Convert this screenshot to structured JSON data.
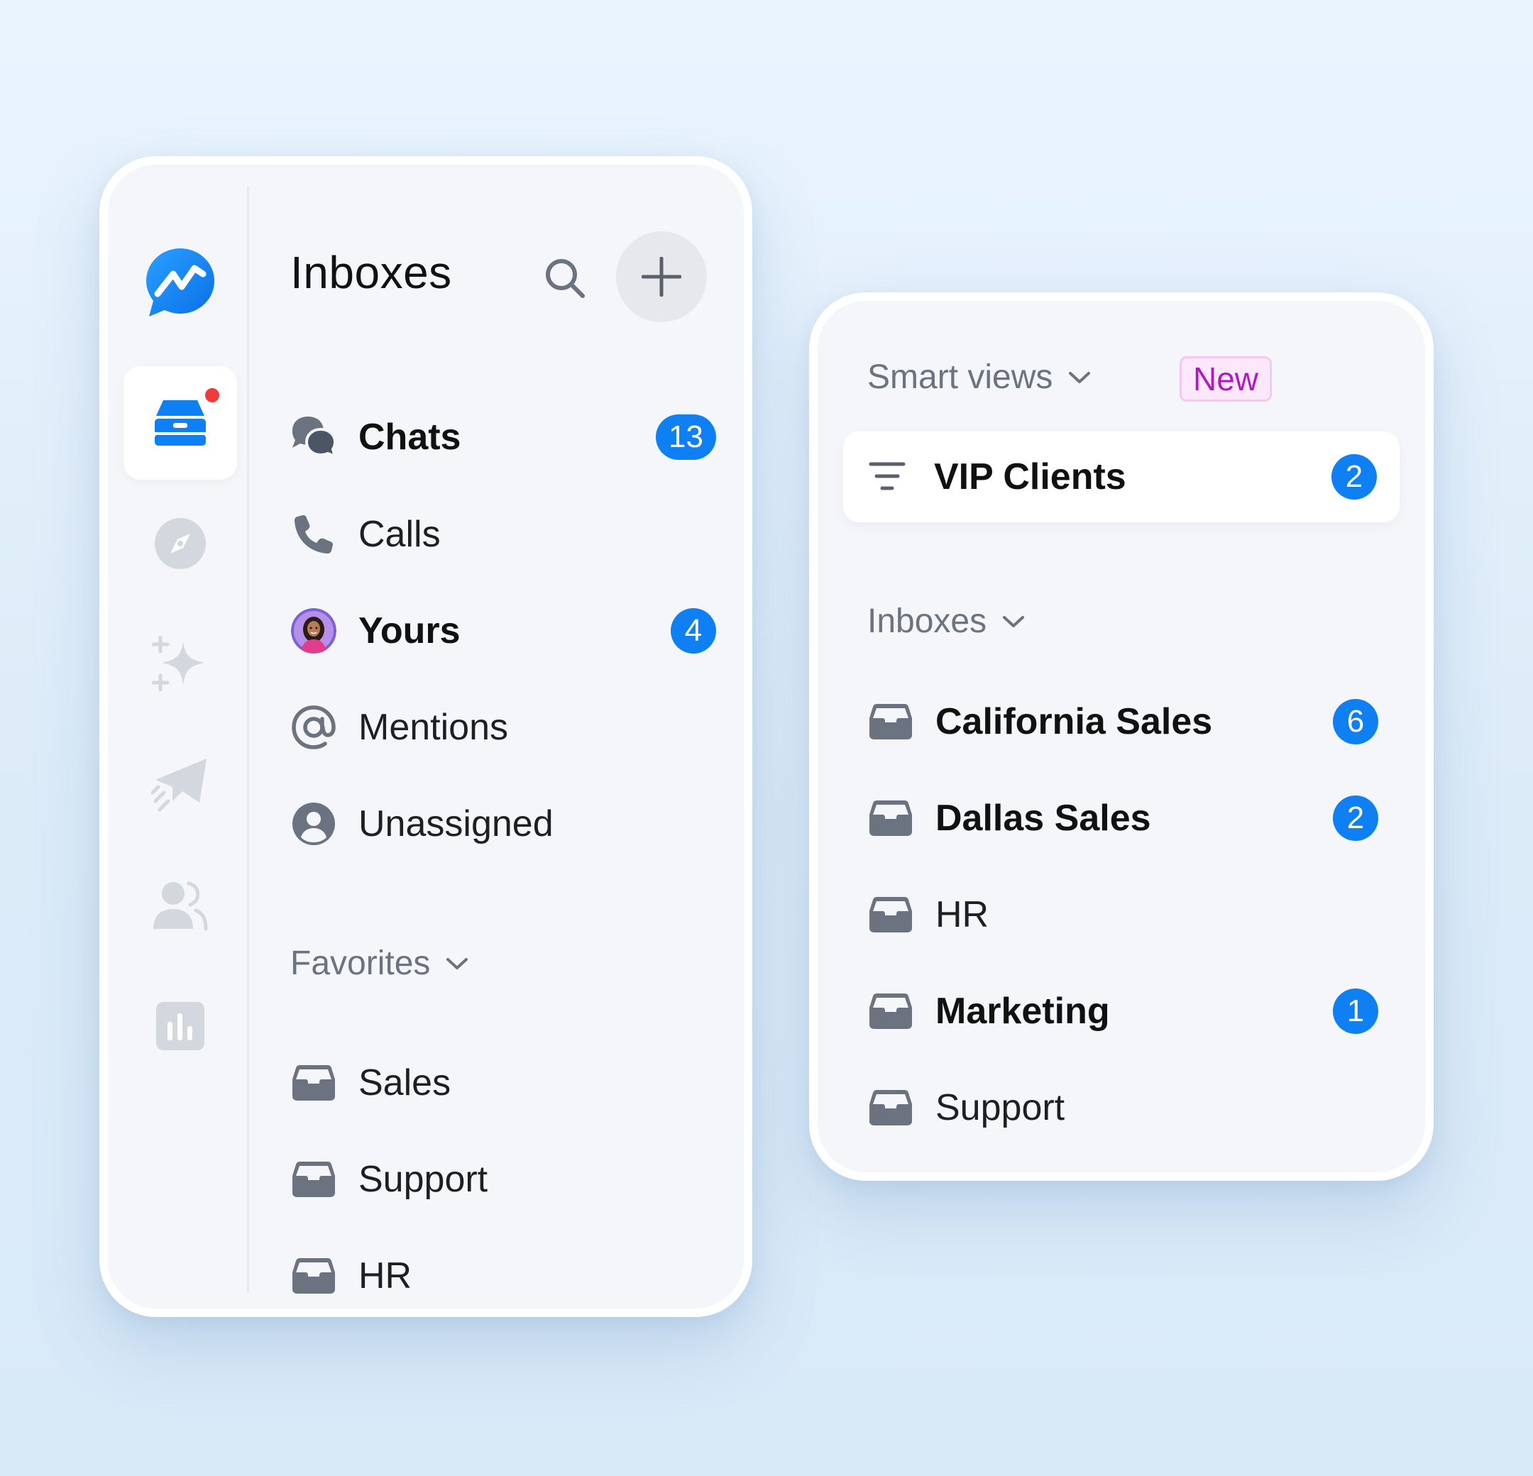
{
  "left_panel": {
    "title": "Inboxes",
    "nav": [
      {
        "label": "Chats",
        "count": "13",
        "bold": true
      },
      {
        "label": "Calls"
      },
      {
        "label": "Yours",
        "count": "4",
        "bold": true
      },
      {
        "label": "Mentions"
      },
      {
        "label": "Unassigned"
      }
    ],
    "favorites": {
      "header": "Favorites",
      "items": [
        {
          "label": "Sales"
        },
        {
          "label": "Support"
        },
        {
          "label": "HR"
        }
      ]
    }
  },
  "right_panel": {
    "smart_views": {
      "header": "Smart views",
      "new_tag": "New"
    },
    "vip": {
      "label": "VIP Clients",
      "count": "2"
    },
    "inboxes": {
      "header": "Inboxes",
      "items": [
        {
          "label": "California Sales",
          "count": "6",
          "bold": true
        },
        {
          "label": "Dallas Sales",
          "count": "2",
          "bold": true
        },
        {
          "label": "HR"
        },
        {
          "label": "Marketing",
          "count": "1",
          "bold": true
        },
        {
          "label": "Support"
        }
      ]
    }
  },
  "rail": {
    "icons": [
      "messenger-logo-icon",
      "inbox-tray-icon",
      "compass-icon",
      "sparkles-icon",
      "paper-plane-icon",
      "people-icon",
      "bar-chart-icon"
    ]
  },
  "colors": {
    "accent": "#0f7ff4",
    "new_tag_text": "#b218c6",
    "notification": "#ef3b3b"
  }
}
